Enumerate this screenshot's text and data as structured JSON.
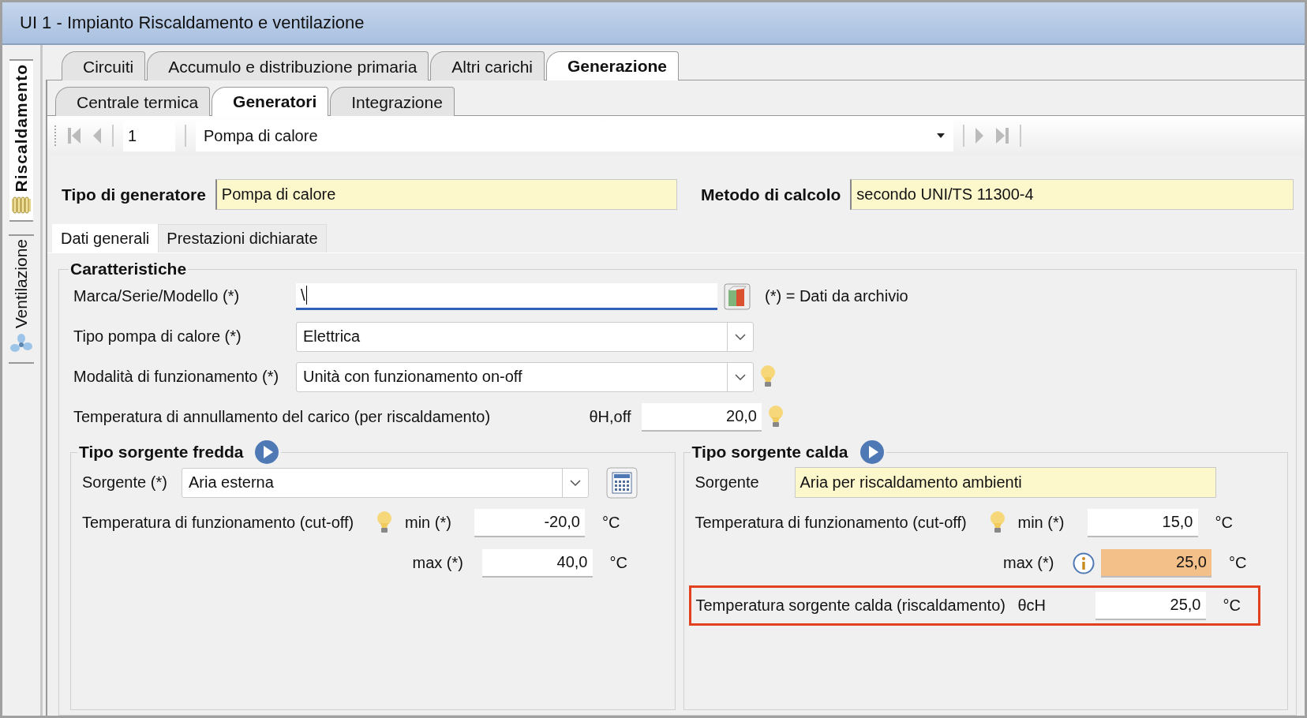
{
  "window": {
    "title": "UI 1 - Impianto Riscaldamento e ventilazione"
  },
  "side_tabs": [
    {
      "label": "Riscaldamento",
      "selected": true,
      "kind": "radiator"
    },
    {
      "label": "Ventilazione",
      "selected": false,
      "kind": "fan"
    }
  ],
  "tabs": [
    {
      "label": "Circuiti",
      "selected": false
    },
    {
      "label": "Accumulo e distribuzione primaria",
      "selected": false
    },
    {
      "label": "Altri carichi",
      "selected": false
    },
    {
      "label": "Generazione",
      "selected": true
    }
  ],
  "subtabs": [
    {
      "label": "Centrale termica",
      "selected": false
    },
    {
      "label": "Generatori",
      "selected": true
    },
    {
      "label": "Integrazione",
      "selected": false
    }
  ],
  "navigator": {
    "record": "1",
    "value": "Pompa di calore"
  },
  "header_fields": [
    {
      "label": "Tipo di generatore",
      "value": "Pompa di calore"
    },
    {
      "label": "Metodo di calcolo",
      "value": "secondo UNI/TS 11300-4"
    }
  ],
  "inner_tabs": [
    {
      "label": "Dati generali",
      "selected": true
    },
    {
      "label": "Prestazioni dichiarate",
      "selected": false
    }
  ],
  "caratteristiche": {
    "title": "Caratteristiche",
    "rows": [
      {
        "kind": "text",
        "label": "Marca/Serie/Modello (*)",
        "value": "\\",
        "note": "(*) = Dati da archivio",
        "hint": false
      },
      {
        "kind": "select",
        "label": "Tipo pompa di calore (*)",
        "value": "Elettrica",
        "hint": false
      },
      {
        "kind": "select",
        "label": "Modalità di funzionamento (*)",
        "value": "Unità con funzionamento on-off",
        "hint": true
      },
      {
        "kind": "number",
        "label": "Temperatura di annullamento del carico (per riscaldamento)",
        "symbol": "θH,off",
        "value": "20,0",
        "hint": true
      }
    ]
  },
  "cold_source": {
    "title": "Tipo sorgente fredda",
    "source_label": "Sorgente (*)",
    "source": "Aria esterna",
    "cutoff_label": "Temperatura di funzionamento (cut-off)",
    "cutoff_hint": true,
    "min_label": "min (*)",
    "min": "-20,0",
    "min_unit": "°C",
    "max_label": "max (*)",
    "max": "40,0",
    "max_unit": "°C"
  },
  "hot_source": {
    "title": "Tipo sorgente calda",
    "source_label": "Sorgente",
    "source": "Aria per riscaldamento ambienti",
    "cutoff_label": "Temperatura di funzionamento (cut-off)",
    "cutoff_hint": true,
    "min_label": "min (*)",
    "min": "15,0",
    "min_unit": "°C",
    "max_label": "max (*)",
    "max_info": true,
    "max_warning": true,
    "max": "25,0",
    "max_unit": "°C",
    "temp_label": "Temperatura sorgente calda (riscaldamento)",
    "temp_symbol": "θcH",
    "temp": "25,0",
    "temp_unit": "°C",
    "emphasized": true
  }
}
